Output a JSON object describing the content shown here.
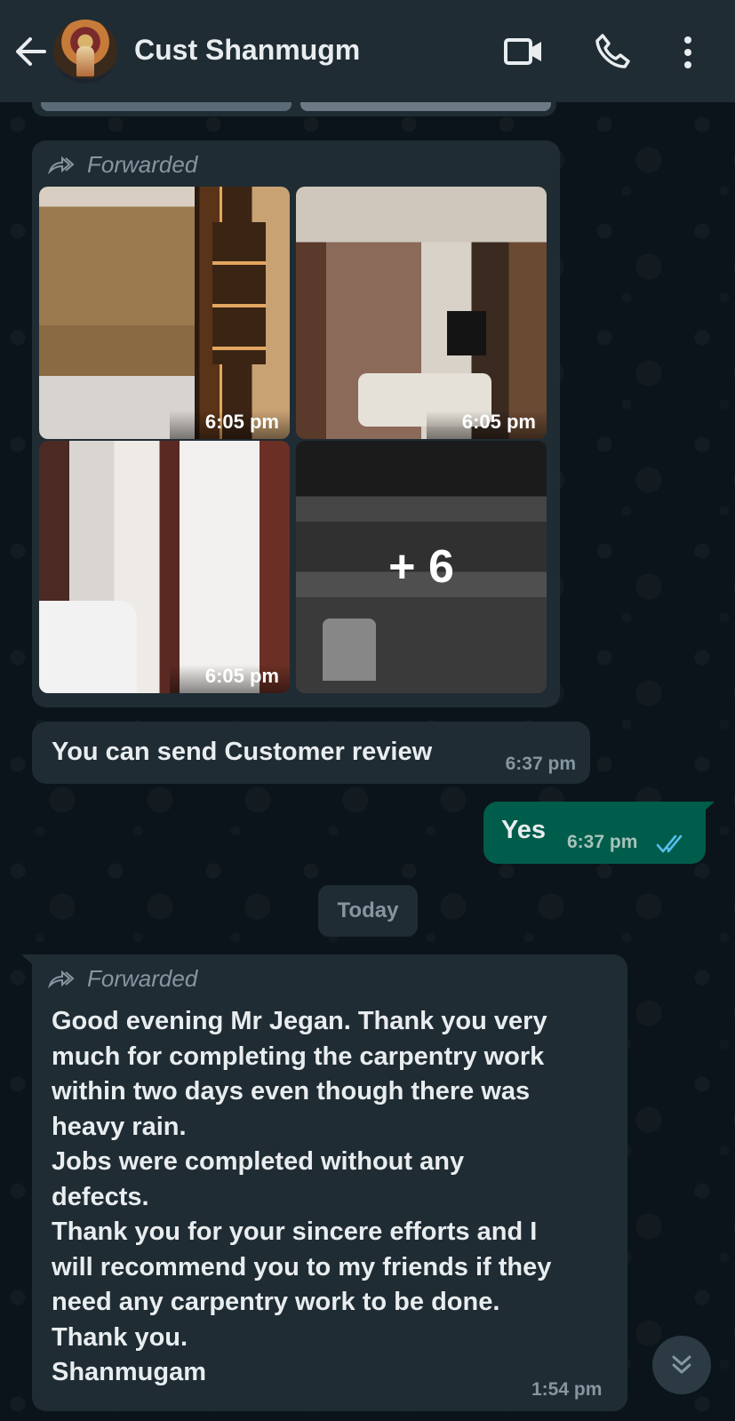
{
  "header": {
    "contact_name": "Cust Shanmugm",
    "icons": [
      "back-arrow-icon",
      "video-call-icon",
      "voice-call-icon",
      "more-options-icon"
    ]
  },
  "album": {
    "forwarded_label": "Forwarded",
    "photos": [
      {
        "time": "6:05 pm"
      },
      {
        "time": "6:05 pm"
      },
      {
        "time": "6:05 pm"
      },
      {
        "more_count": "+ 6"
      }
    ]
  },
  "messages": [
    {
      "direction": "in",
      "text": "You can send Customer review",
      "time": "6:37 pm"
    },
    {
      "direction": "out",
      "text": "Yes",
      "time": "6:37 pm",
      "status": "read"
    }
  ],
  "date_divider": "Today",
  "forwarded_message": {
    "forwarded_label": "Forwarded",
    "text": "Good evening Mr Jegan. Thank you very\nmuch for completing the carpentry work\nwithin two days even though there was\nheavy rain.\nJobs were completed without any\ndefects.\nThank you for your sincere efforts and I\nwill recommend you to my friends if they\nneed any carpentry work to be done.\nThank you.\nShanmugam",
    "time": "1:54 pm"
  },
  "colors": {
    "header_bg": "#1f2c34",
    "incoming_bubble": "#1f2c34",
    "outgoing_bubble": "#005c4b",
    "read_ticks": "#53bdeb",
    "background": "#0b141a"
  }
}
